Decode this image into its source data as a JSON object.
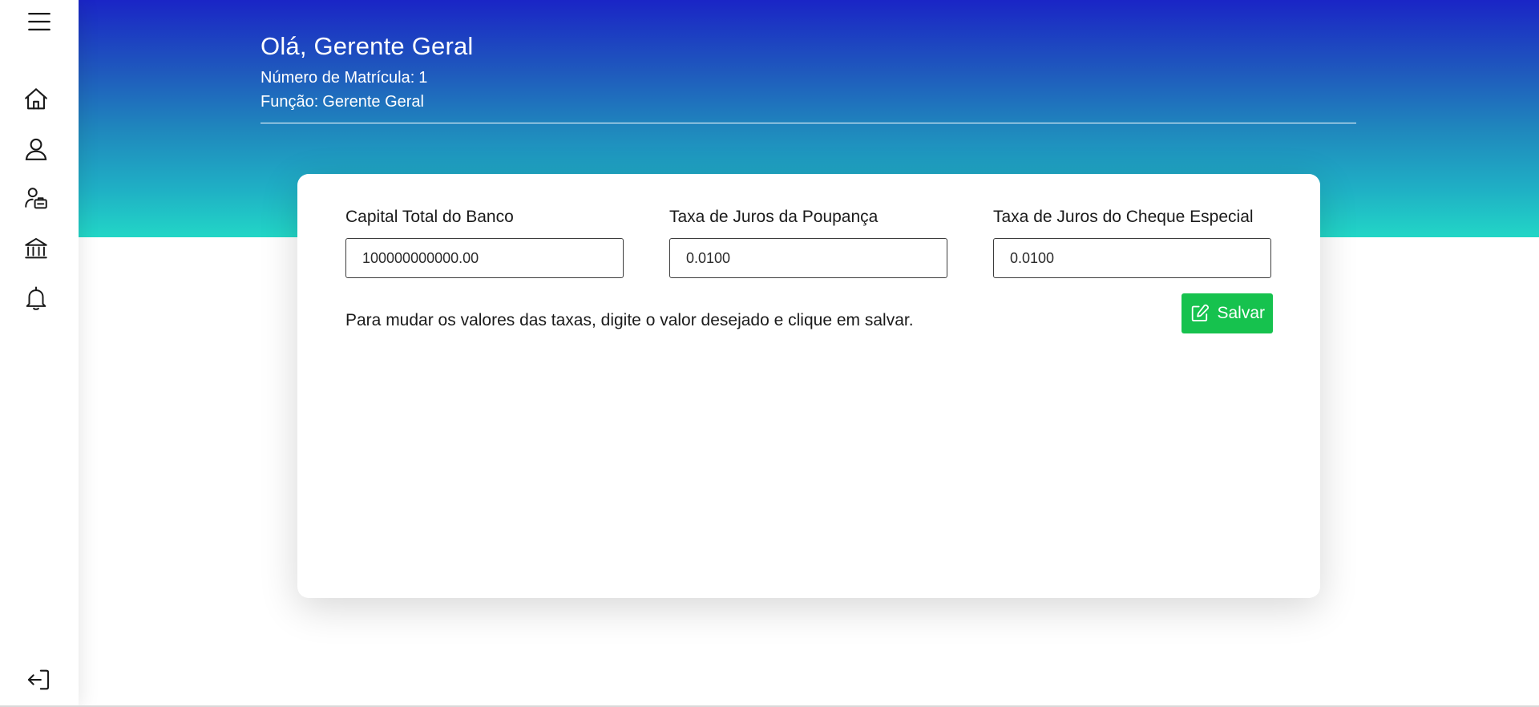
{
  "sidebar": {
    "items": [
      {
        "name": "menu",
        "icon": "hamburger-menu-icon"
      },
      {
        "name": "home",
        "icon": "home-icon"
      },
      {
        "name": "profile",
        "icon": "user-icon"
      },
      {
        "name": "employees",
        "icon": "user-badge-icon"
      },
      {
        "name": "bank",
        "icon": "bank-icon"
      },
      {
        "name": "notifications",
        "icon": "bell-icon"
      },
      {
        "name": "logout",
        "icon": "logout-icon"
      }
    ]
  },
  "header": {
    "greeting": "Olá, Gerente Geral",
    "registration_label": "Número de Matrícula:",
    "registration_value": "1",
    "role_label": "Função:",
    "role_value": "Gerente Geral"
  },
  "form": {
    "fields": [
      {
        "label": "Capital Total do Banco",
        "value": "100000000000.00"
      },
      {
        "label": "Taxa de Juros da Poupança",
        "value": "0.0100"
      },
      {
        "label": "Taxa de Juros do Cheque Especial",
        "value": "0.0100"
      }
    ],
    "help_text": "Para mudar os valores das taxas, digite o valor desejado e clique em salvar.",
    "save_label": "Salvar"
  },
  "colors": {
    "banner_top": "#1a25c6",
    "banner_bottom": "#22d6c6",
    "save_button": "#16c24e"
  }
}
